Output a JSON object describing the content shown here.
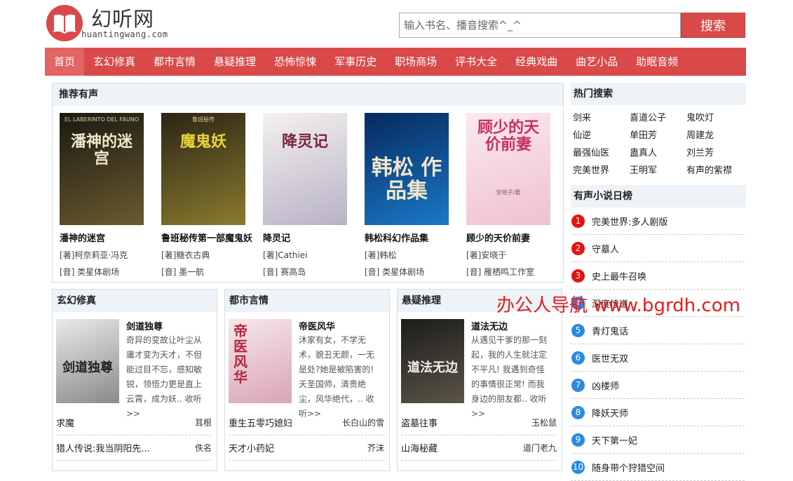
{
  "site": {
    "name": "幻听网",
    "domain": "huantingwang.com"
  },
  "search": {
    "placeholder": "输入书名、播音搜索^_^",
    "button": "搜索"
  },
  "nav": [
    "首页",
    "玄幻修真",
    "都市言情",
    "悬疑推理",
    "恐怖惊悚",
    "军事历史",
    "职场商场",
    "评书大全",
    "经典戏曲",
    "曲艺小品",
    "助眠音频"
  ],
  "recommend": {
    "title": "推荐有声",
    "books": [
      {
        "cover_text": "潘神的迷宫",
        "cover_sub": "EL LABERINTO DEL FAUNO",
        "title": "潘神的迷宫",
        "author": "[著]柯奈莉亚·冯克",
        "narrator": "[音] 类星体剧场",
        "colors": [
          "#1a1a12",
          "#6b5a2e"
        ]
      },
      {
        "cover_text": "魔鬼妖",
        "cover_sub": "鲁班秘传",
        "title": "鲁班秘传第一部魔鬼妖",
        "author": "[著]糖衣古典",
        "narrator": "[音] 墨一航",
        "colors": [
          "#2c2416",
          "#8a7c2e"
        ]
      },
      {
        "cover_text": "降灵记",
        "cover_sub": "",
        "title": "降灵记",
        "author": "[著]Cathiei",
        "narrator": "[音] 赛高岛",
        "colors": [
          "#f4f1ee",
          "#b8b2c6"
        ]
      },
      {
        "cover_text": "韩松 作品集",
        "cover_sub": "",
        "title": "韩松科幻作品集",
        "author": "[著]韩松",
        "narrator": "[音] 类星体剧场",
        "colors": [
          "#062a5e",
          "#1a78c8"
        ]
      },
      {
        "cover_text": "顾少的天价前妻",
        "cover_sub": "安晓子/著",
        "title": "顾少的天价前妻",
        "author": "[著]安晓于",
        "narrator": "[音] 雁栖鸣工作室",
        "colors": [
          "#fbe9ef",
          "#efc0d2"
        ]
      }
    ]
  },
  "hot_search": {
    "title": "热门搜索",
    "items": [
      "剑来",
      "喜道公子",
      "鬼吹灯",
      "仙逆",
      "单田芳",
      "周建龙",
      "最强仙医",
      "蛊真人",
      "刘兰芳",
      "完美世界",
      "王明军",
      "有声的紫襟"
    ]
  },
  "daily_rank": {
    "title": "有声小说日榜",
    "items": [
      {
        "num": "1",
        "title": "完美世界:多人剧版",
        "color": "#e8110f"
      },
      {
        "num": "2",
        "title": "守墓人",
        "color": "#e8110f"
      },
      {
        "num": "3",
        "title": "史上最牛召唤",
        "color": "#e8110f"
      },
      {
        "num": "4",
        "title": "深度惊道",
        "color": "#2a8ae0"
      },
      {
        "num": "5",
        "title": "青灯鬼话",
        "color": "#2a8ae0"
      },
      {
        "num": "6",
        "title": "医世无双",
        "color": "#2a8ae0"
      },
      {
        "num": "7",
        "title": "凶楼师",
        "color": "#2a8ae0"
      },
      {
        "num": "8",
        "title": "降妖天师",
        "color": "#2a8ae0"
      },
      {
        "num": "9",
        "title": "天下第一妃",
        "color": "#2a8ae0"
      },
      {
        "num": "10",
        "title": "随身带个狩猎空间",
        "color": "#2a8ae0"
      }
    ]
  },
  "categories": [
    {
      "title": "玄幻修真",
      "feature": {
        "title": "剑道独尊",
        "cover_text": "剑道独尊",
        "desc": "奇异的变故让叶尘从庸才变为天才，不但能过目不忘，感知敏锐，领悟力更是直上云霄，成为妖.. 收听>>",
        "colors": [
          "#e9e9e9",
          "#8a8a8a"
        ]
      },
      "rows": [
        {
          "title": "求魔",
          "author": "耳根"
        },
        {
          "title": "猎人传说:我当阴阳先...",
          "author": "佚名"
        }
      ]
    },
    {
      "title": "都市言情",
      "feature": {
        "title": "帝医风华",
        "cover_text": "帝医风华",
        "desc": "沐家有女，不学无术，貌丑无颜，一无是处?她是被陷害的! 天圣国师，清贵绝尘，风华绝代，.. 收听>>",
        "colors": [
          "#f6e7ec",
          "#d9a3b6"
        ]
      },
      "rows": [
        {
          "title": "重生五零巧媳妇",
          "author": "长白山的雪"
        },
        {
          "title": "天才小药妃",
          "author": "芥沫"
        }
      ]
    },
    {
      "title": "悬疑推理",
      "feature": {
        "title": "道法无边",
        "cover_text": "道法无边",
        "desc": "从遇见干爹的那一刻起，我的人生就注定不平凡! 我遇到奇怪的事情很正常! 而我身边的朋友都.. 收听>>",
        "colors": [
          "#1c1c1a",
          "#5b5546"
        ]
      },
      "rows": [
        {
          "title": "盗墓往事",
          "author": "玉松鼠"
        },
        {
          "title": "山海秘藏",
          "author": "道门老九"
        }
      ]
    }
  ],
  "watermark": "办公人导航 www.bgrdh.com",
  "colors": {
    "brand": "#d94949",
    "rank_top": "#e8110f",
    "rank_rest": "#2a8ae0"
  }
}
